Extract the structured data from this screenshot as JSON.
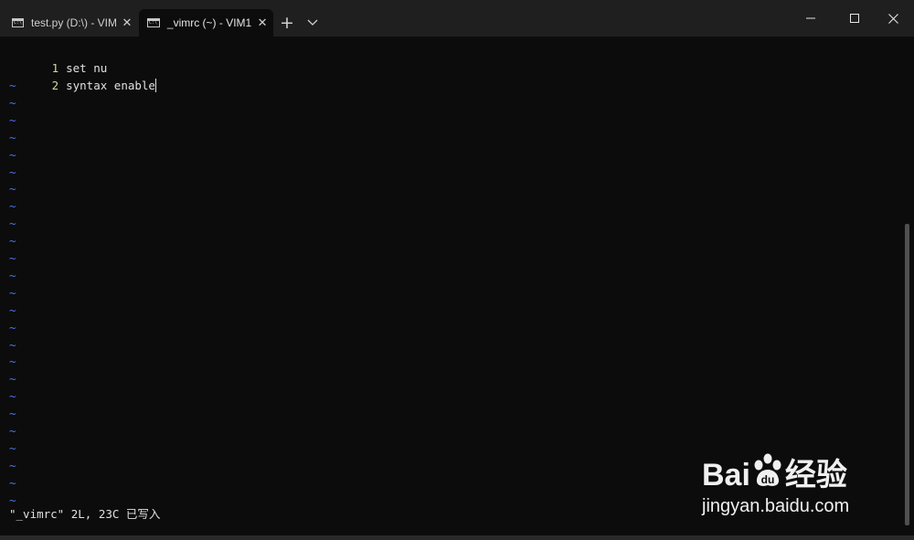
{
  "tabs": [
    {
      "label": "test.py (D:\\) - VIM",
      "active": false
    },
    {
      "label": "_vimrc (~) - VIM1",
      "active": true
    }
  ],
  "icons": {
    "tab_icon": "terminal-icon",
    "close": "close-icon",
    "new_tab": "plus-icon",
    "dropdown": "chevron-down-icon",
    "minimize": "minimize-icon",
    "maximize": "maximize-icon",
    "window_close": "window-close-icon"
  },
  "buffer": {
    "lines": [
      {
        "number": "1",
        "text": "set nu"
      },
      {
        "number": "2",
        "text": "syntax enable"
      }
    ],
    "tilde": "~"
  },
  "status": "\"_vimrc\" 2L, 23C 已写入",
  "watermark": {
    "logo": "Bai",
    "logo_suffix": "经验",
    "url": "jingyan.baidu.com"
  },
  "colors": {
    "background": "#0c0c0c",
    "titlebar": "#1f1f1f",
    "line_number": "#d6d6a0",
    "tilde": "#4a78e6",
    "text": "#e0e0e0"
  }
}
